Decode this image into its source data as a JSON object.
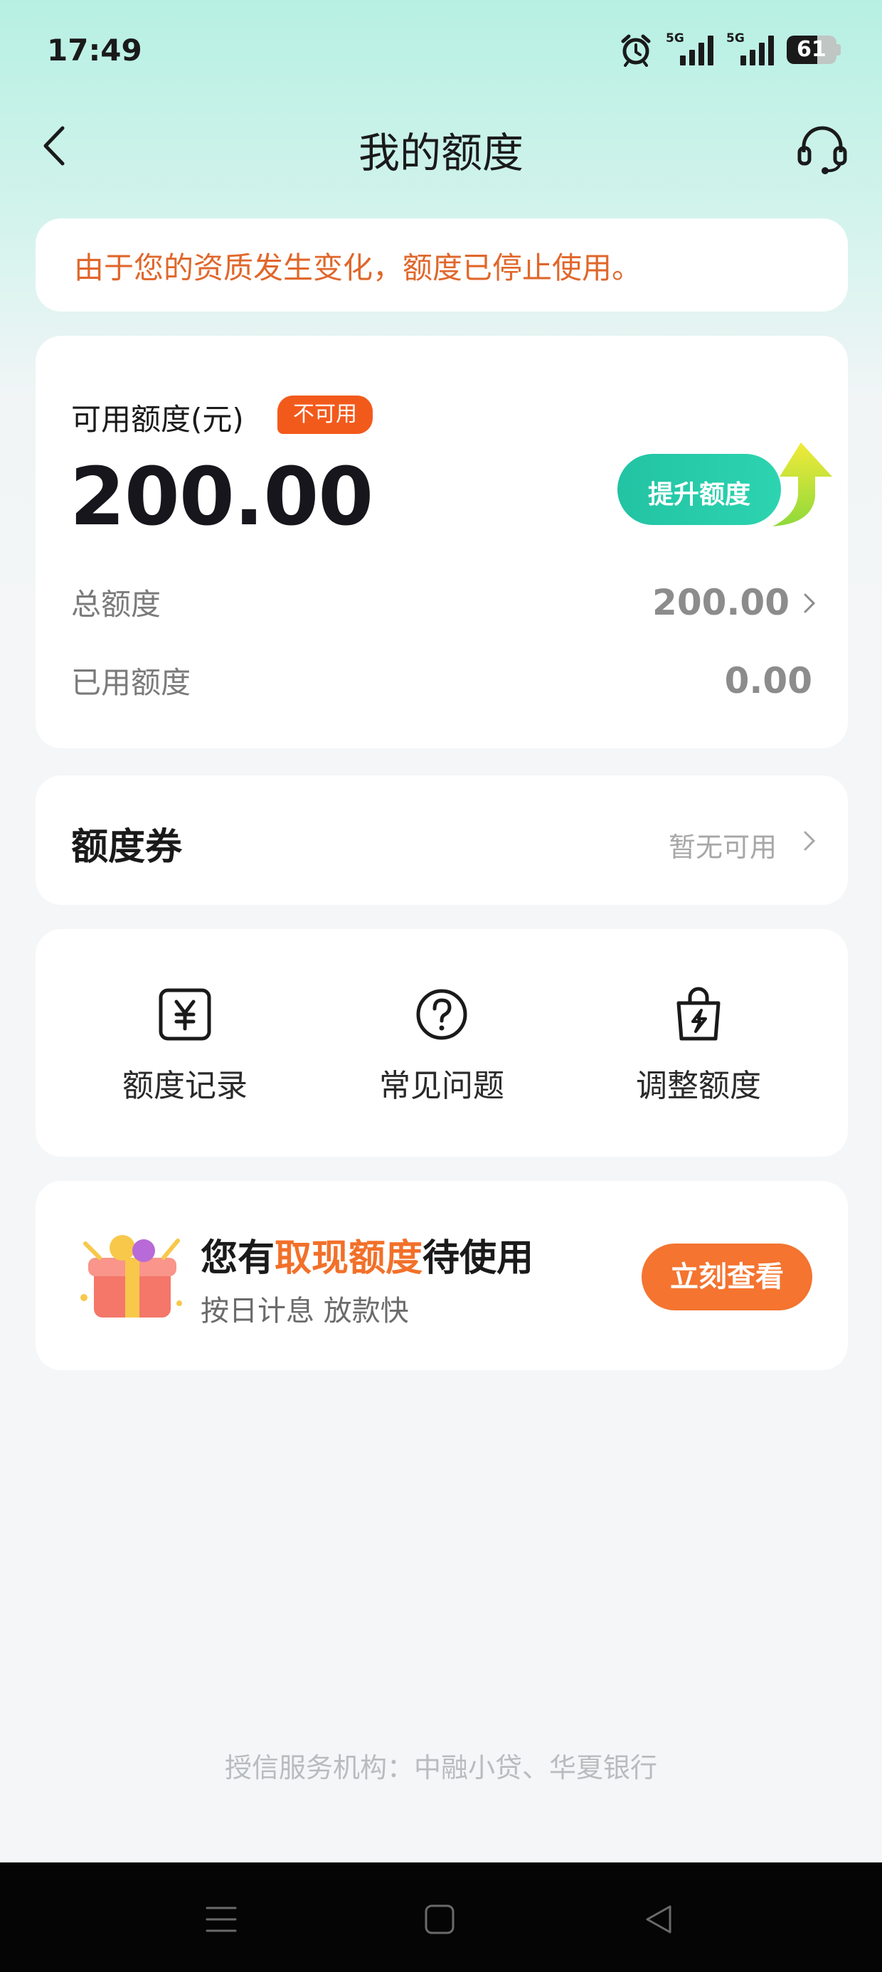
{
  "status_bar": {
    "time": "17:49",
    "signal_1_tag": "5G",
    "signal_2_tag": "5G",
    "battery_level": "61",
    "icons": [
      "alarm-icon",
      "signal-5g-icon",
      "signal-5g-icon",
      "battery-icon"
    ]
  },
  "header": {
    "title": "我的额度",
    "back_icon": "chevron-left-icon",
    "support_icon": "headset-icon"
  },
  "notice": {
    "text": "由于您的资质发生变化，额度已停止使用。"
  },
  "quota": {
    "label": "可用额度(元)",
    "badge": "不可用",
    "amount": "200.00",
    "raise_button": "提升额度",
    "total_label": "总额度",
    "total_value": "200.00",
    "used_label": "已用额度",
    "used_value": "0.00"
  },
  "coupon": {
    "title": "额度券",
    "status": "暂无可用"
  },
  "shortcuts": [
    {
      "label": "额度记录",
      "icon": "yen-receipt-icon"
    },
    {
      "label": "常见问题",
      "icon": "question-circle-icon"
    },
    {
      "label": "调整额度",
      "icon": "lightning-bag-icon"
    }
  ],
  "promo": {
    "title_prefix": "您有",
    "title_highlight": "取现额度",
    "title_suffix": "待使用",
    "subtitle": "按日计息 放款快",
    "button": "立刻查看",
    "icon": "gift-box-icon"
  },
  "footer": {
    "text": "授信服务机构：中融小贷、华夏银行"
  },
  "nav": {
    "icons": [
      "menu-icon",
      "home-square-icon",
      "back-triangle-icon"
    ]
  },
  "colors": {
    "accent_teal": "#22c3a4",
    "warning_orange": "#e0672b",
    "badge_red_orange": "#f25a1c",
    "cta_orange": "#f47430"
  }
}
